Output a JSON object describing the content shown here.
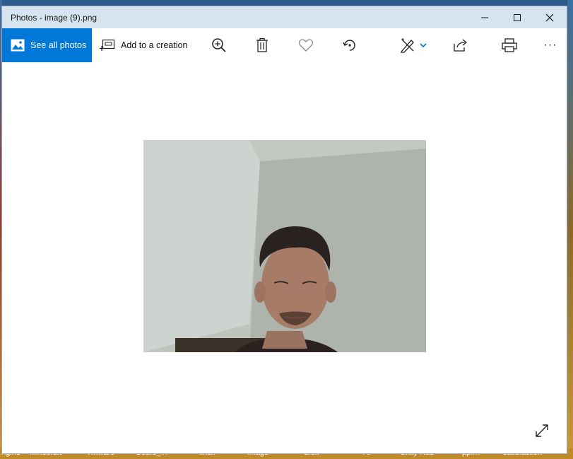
{
  "window": {
    "title": "Photos - image (9).png",
    "controls": {
      "minimize": "—",
      "maximize": "☐",
      "close": "✕"
    }
  },
  "toolbar": {
    "see_all_label": "See all photos",
    "add_creation_label": "Add to a creation",
    "buttons": [
      "zoom-in-icon",
      "delete-icon",
      "favorite-heart-icon",
      "rotate-icon",
      "edit-create-icon",
      "share-icon",
      "print-icon",
      "more-options-icon"
    ],
    "more_label": "···"
  },
  "taskbar_labels": [
    "ngine",
    "Minecraft",
    "VMware",
    "Cours_TP",
    "linux",
    "image",
    "droit",
    "Ai",
    "Unity Hub",
    "ppfm",
    "satisfaction"
  ],
  "colors": {
    "accent": "#0078d7",
    "titlebar": "#d6e4f0"
  }
}
